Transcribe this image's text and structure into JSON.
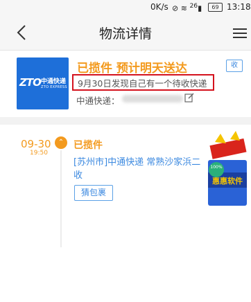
{
  "statusbar": {
    "speed": "0K/s",
    "time": "13:18",
    "battery": "69",
    "signal": "26"
  },
  "nav": {
    "title": "物流详情"
  },
  "package": {
    "status": "已揽件 预计明天送达",
    "collect_tag": "收",
    "note": "9月30日发现自己有一个待收快递",
    "company_label": "中通快递：",
    "logo": {
      "mark": "ZTO",
      "cn": "中通快递",
      "en": "ZTO EXPRESS",
      "color": "#1e6fd9"
    }
  },
  "timeline": {
    "date": "09-30",
    "time": "19:50",
    "event_title": "已揽件",
    "event_detail": "[苏州市]中通快递 常熟沙家浜二收",
    "guess_button": "猜包裹"
  },
  "promo": {
    "label": "惠惠软件",
    "badge": "100%"
  },
  "colors": {
    "accent": "#f39a1e",
    "link": "#3d8ae0",
    "highlight": "#d4121d"
  }
}
